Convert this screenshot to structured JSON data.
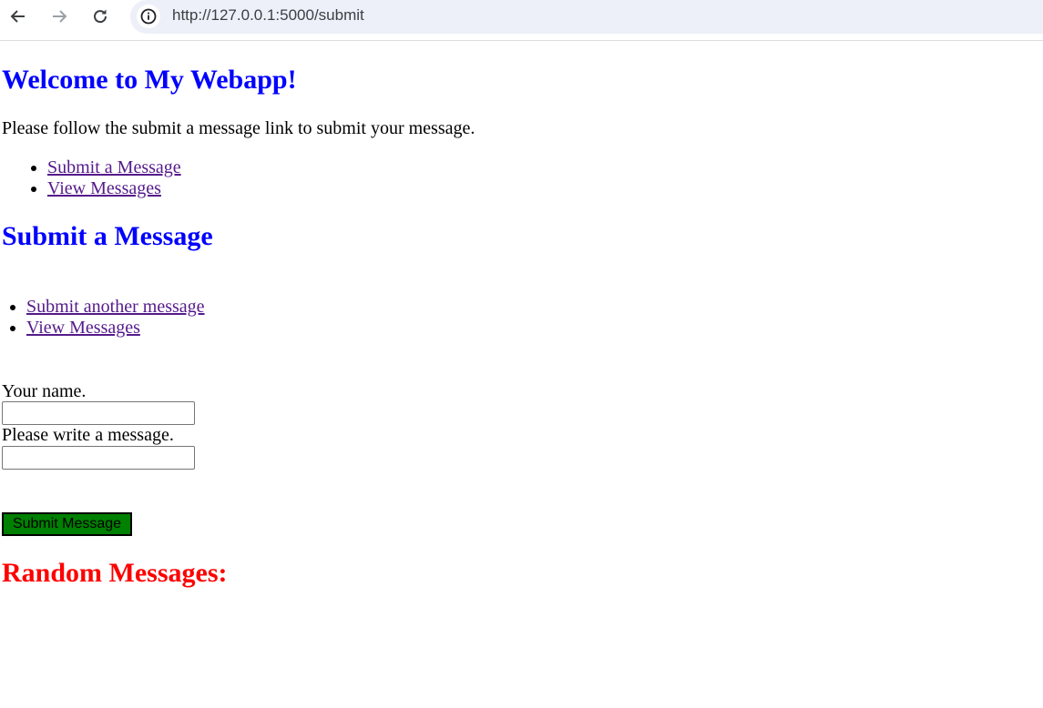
{
  "browser": {
    "url": "http://127.0.0.1:5000/submit",
    "icons": {
      "back": "arrow-left-icon",
      "forward": "arrow-right-icon",
      "reload": "reload-icon",
      "site_info": "info-circle-icon"
    }
  },
  "header": {
    "title": "Welcome to My Webapp!",
    "intro": "Please follow the submit a message link to submit your message."
  },
  "nav": {
    "items": [
      {
        "label": "Submit a Message"
      },
      {
        "label": "View Messages"
      }
    ]
  },
  "submit_section": {
    "title": "Submit a Message",
    "links": [
      {
        "label": "Submit another message"
      },
      {
        "label": "View Messages"
      }
    ]
  },
  "form": {
    "name_label": "Your name.",
    "name_value": "",
    "message_label": "Please write a message.",
    "message_value": "",
    "submit_label": "Submit Message"
  },
  "messages_section": {
    "title": "Random Messages:"
  },
  "colors": {
    "heading_blue": "#0000ff",
    "heading_red": "#ff0000",
    "visited_link": "#551a8b",
    "submit_button": "#008000",
    "address_bar": "#edf0f8"
  }
}
